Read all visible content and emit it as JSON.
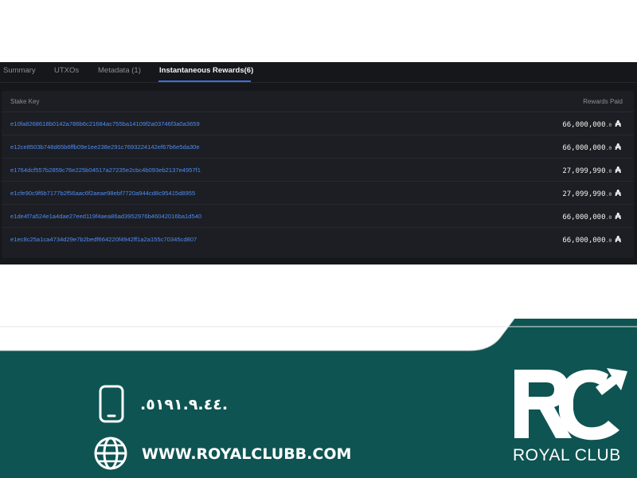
{
  "tabs": [
    {
      "label": "Summary"
    },
    {
      "label": "UTXOs"
    },
    {
      "label": "Metadata (1)"
    },
    {
      "label": "Instantaneous Rewards(6)",
      "active": true
    }
  ],
  "table": {
    "col_stake_key": "Stake Key",
    "col_rewards": "Rewards Paid",
    "currency_symbol": "₳",
    "rows": [
      {
        "stake_key": "e10fa8268618b0142a786b6c21684ac755ba14109f2a03746f3a0a3659",
        "amount": "66,000,000",
        "decimals": ".0"
      },
      {
        "stake_key": "e12ce8503b748d65b6ffb09e1ee238e291c7693224142ef67b6e5da30e",
        "amount": "66,000,000",
        "decimals": ".0"
      },
      {
        "stake_key": "e1764dcf557b2859c76e225b04517a27235e2cbc4b093eb2137e4957f1",
        "amount": "27,099,990",
        "decimals": ".0"
      },
      {
        "stake_key": "e1cfe90c9f6b7177b2f56aac6f2aeae98ebf7720a944cd8c95415d8955",
        "amount": "27,099,990",
        "decimals": ".0"
      },
      {
        "stake_key": "e1de4f7a524e1a4dae27eed119f4aea86ad3952976b46042016ba1d540",
        "amount": "66,000,000",
        "decimals": ".0"
      },
      {
        "stake_key": "e1ec8c25a1ca4734d29e7b2bedf664220f4942ff1a2a155c70345cd807",
        "amount": "66,000,000",
        "decimals": ".0"
      }
    ]
  },
  "ad": {
    "phone": ".٥١٩١.٩.٤٤.",
    "website": "WWW.ROYALCLUBB.COM",
    "brand_name": "ROYAL CLUB",
    "colors": {
      "band": "#0e5452",
      "text": "#ffffff",
      "link": "#4a8cf7",
      "tab_active": "#3b6fe0"
    }
  }
}
